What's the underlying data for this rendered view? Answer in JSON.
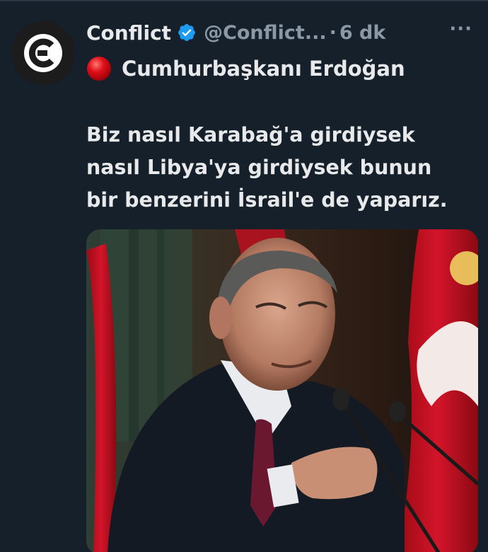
{
  "tweet": {
    "display_name": "Conflict",
    "handle": "@Conflict...",
    "separator": "·",
    "time": "6 dk",
    "more_label": "···",
    "headline": "Cumhurbaşkanı Erdoğan",
    "body_lines": [
      "Biz nasıl Karabağ'a girdiysek",
      "nasıl Libya'ya girdiysek bunun",
      "bir benzerini İsrail'e de yaparız."
    ]
  },
  "icons": {
    "avatar": "conflict-logo-icon",
    "verified": "verified-badge-icon",
    "headline_marker": "red-circle-icon",
    "more": "more-options-icon"
  },
  "colors": {
    "background": "#15202b",
    "text": "#e7e9ea",
    "secondary_text": "#8b98a5",
    "verified_blue": "#1d9bf0",
    "red_circle": "#e0101a",
    "flag_red": "#c8102e"
  }
}
